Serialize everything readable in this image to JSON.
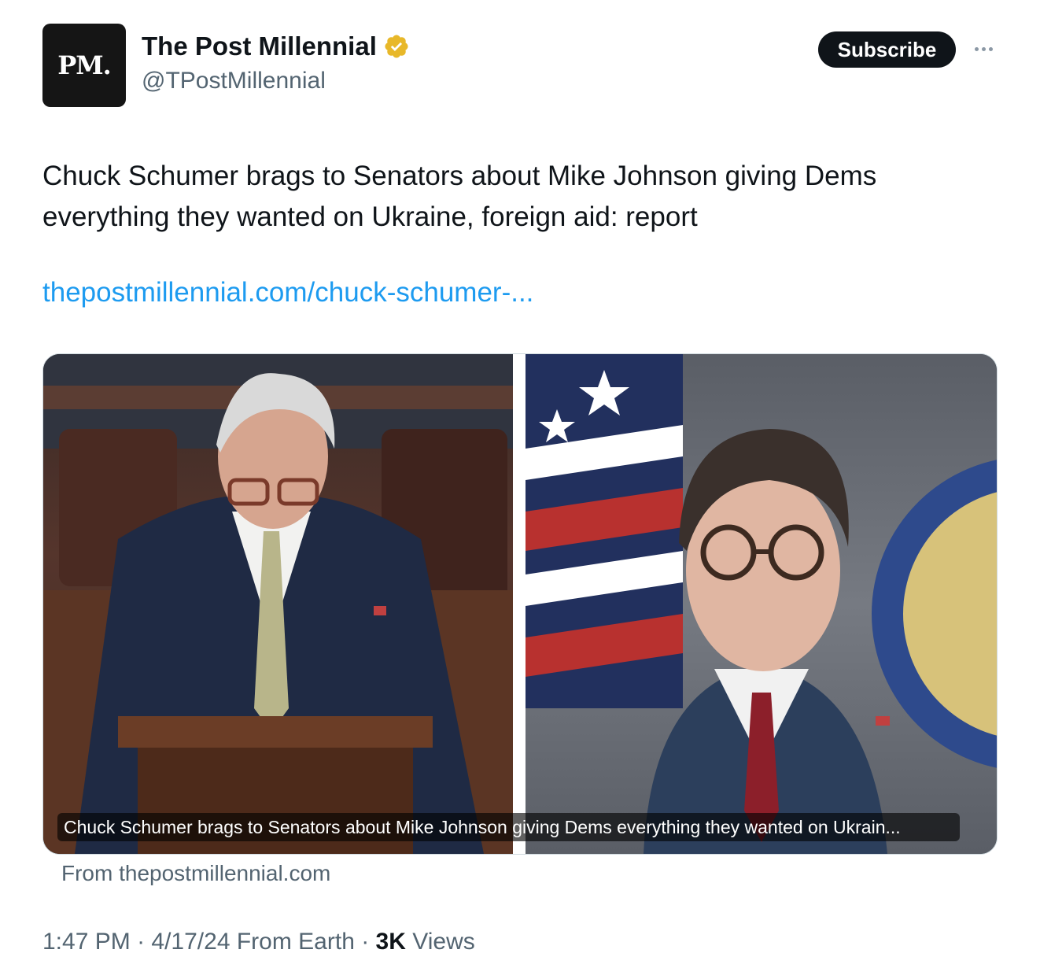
{
  "author": {
    "avatar_text": "PM.",
    "display_name": "The Post Millennial",
    "handle": "@TPostMillennial",
    "verified_color": "#e8b829"
  },
  "actions": {
    "subscribe_label": "Subscribe",
    "more_icon": "more-horizontal-icon"
  },
  "tweet": {
    "text": "Chuck Schumer brags to Senators about Mike Johnson giving Dems everything they wanted on Ukraine, foreign aid: report",
    "link": "thepostmillennial.com/chuck-schumer-..."
  },
  "card": {
    "caption": "Chuck Schumer brags to Senators about Mike Johnson giving Dems everything they wanted on Ukrain...",
    "source": "From thepostmillennial.com"
  },
  "meta": {
    "time": "1:47 PM",
    "date": "4/17/24",
    "location": "From Earth",
    "views_count": "3K",
    "views_label": "Views"
  },
  "colors": {
    "link": "#1d9bf0",
    "secondary_text": "#536471",
    "primary_text": "#0f1419"
  }
}
